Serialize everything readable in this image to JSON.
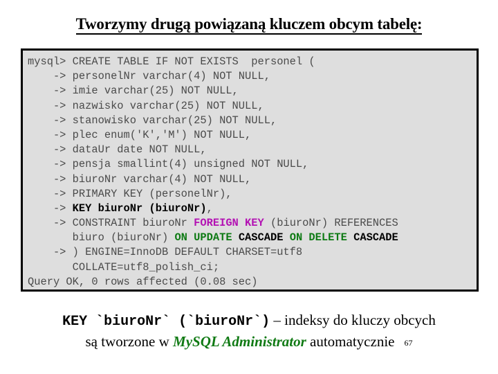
{
  "slide": {
    "title": "Tworzymy drugą powiązaną kluczem obcym tabelę:",
    "page_number": "67"
  },
  "colors": {
    "console_background": "#dedede",
    "console_border": "#000000",
    "console_text": "#4a4a4a",
    "bold_text": "#000000",
    "foreign_key_accent": "#b312b3",
    "cascade_accent": "#0e7a14",
    "caption_accent": "#107a14"
  },
  "console": {
    "prompt": "mysql>",
    "continuation_prompt": "->",
    "lines": [
      {
        "id": "line-1",
        "tokens": [
          {
            "text": "mysql> CREATE TABLE IF NOT EXISTS  personel (",
            "style": "plain"
          }
        ]
      },
      {
        "id": "line-2",
        "tokens": [
          {
            "text": "    -> personelNr varchar(4) NOT NULL,",
            "style": "plain"
          }
        ]
      },
      {
        "id": "line-3",
        "tokens": [
          {
            "text": "    -> imie varchar(25) NOT NULL,",
            "style": "plain"
          }
        ]
      },
      {
        "id": "line-4",
        "tokens": [
          {
            "text": "    -> nazwisko varchar(25) NOT NULL,",
            "style": "plain"
          }
        ]
      },
      {
        "id": "line-5",
        "tokens": [
          {
            "text": "    -> stanowisko varchar(25) NOT NULL,",
            "style": "plain"
          }
        ]
      },
      {
        "id": "line-6",
        "tokens": [
          {
            "text": "    -> plec enum('K','M') NOT NULL,",
            "style": "plain"
          }
        ]
      },
      {
        "id": "line-7",
        "tokens": [
          {
            "text": "    -> dataUr date NOT NULL,",
            "style": "plain"
          }
        ]
      },
      {
        "id": "line-8",
        "tokens": [
          {
            "text": "    -> pensja smallint(4) unsigned NOT NULL,",
            "style": "plain"
          }
        ]
      },
      {
        "id": "line-9",
        "tokens": [
          {
            "text": "    -> biuroNr varchar(4) NOT NULL,",
            "style": "plain"
          }
        ]
      },
      {
        "id": "line-10",
        "tokens": [
          {
            "text": "    -> PRIMARY KEY (personelNr),",
            "style": "plain"
          }
        ]
      },
      {
        "id": "line-11",
        "tokens": [
          {
            "text": "    -> ",
            "style": "plain"
          },
          {
            "text": "KEY biuroNr (biuroNr)",
            "style": "bold"
          },
          {
            "text": ",",
            "style": "plain"
          }
        ]
      },
      {
        "id": "line-12",
        "tokens": [
          {
            "text": "    -> CONSTRAINT biuroNr ",
            "style": "plain"
          },
          {
            "text": "FOREIGN KEY",
            "style": "fk"
          },
          {
            "text": " (biuroNr) REFERENCES",
            "style": "plain"
          }
        ]
      },
      {
        "id": "line-13",
        "tokens": [
          {
            "text": "       biuro (biuroNr) ",
            "style": "plain"
          },
          {
            "text": "ON UPDATE",
            "style": "green"
          },
          {
            "text": " ",
            "style": "plain"
          },
          {
            "text": "CASCADE",
            "style": "bold"
          },
          {
            "text": " ",
            "style": "plain"
          },
          {
            "text": "ON DELETE",
            "style": "green"
          },
          {
            "text": " ",
            "style": "plain"
          },
          {
            "text": "CASCADE",
            "style": "bold"
          }
        ]
      },
      {
        "id": "line-14",
        "tokens": [
          {
            "text": "    -> ) ENGINE=InnoDB DEFAULT CHARSET=utf8",
            "style": "plain"
          }
        ]
      },
      {
        "id": "line-15",
        "tokens": [
          {
            "text": "       COLLATE=utf8_polish_ci;",
            "style": "plain"
          }
        ]
      },
      {
        "id": "line-16",
        "tokens": [
          {
            "text": "Query OK, 0 rows affected (0.08 sec)",
            "style": "plain"
          }
        ]
      }
    ]
  },
  "caption": {
    "line1": {
      "code": "KEY `biuroNr` (`biuroNr`)",
      "text": " – indeksy do kluczy obcych"
    },
    "line2": {
      "prefix": "są tworzone w ",
      "accent": "MySQL Administrator",
      "suffix": " automatycznie"
    }
  }
}
